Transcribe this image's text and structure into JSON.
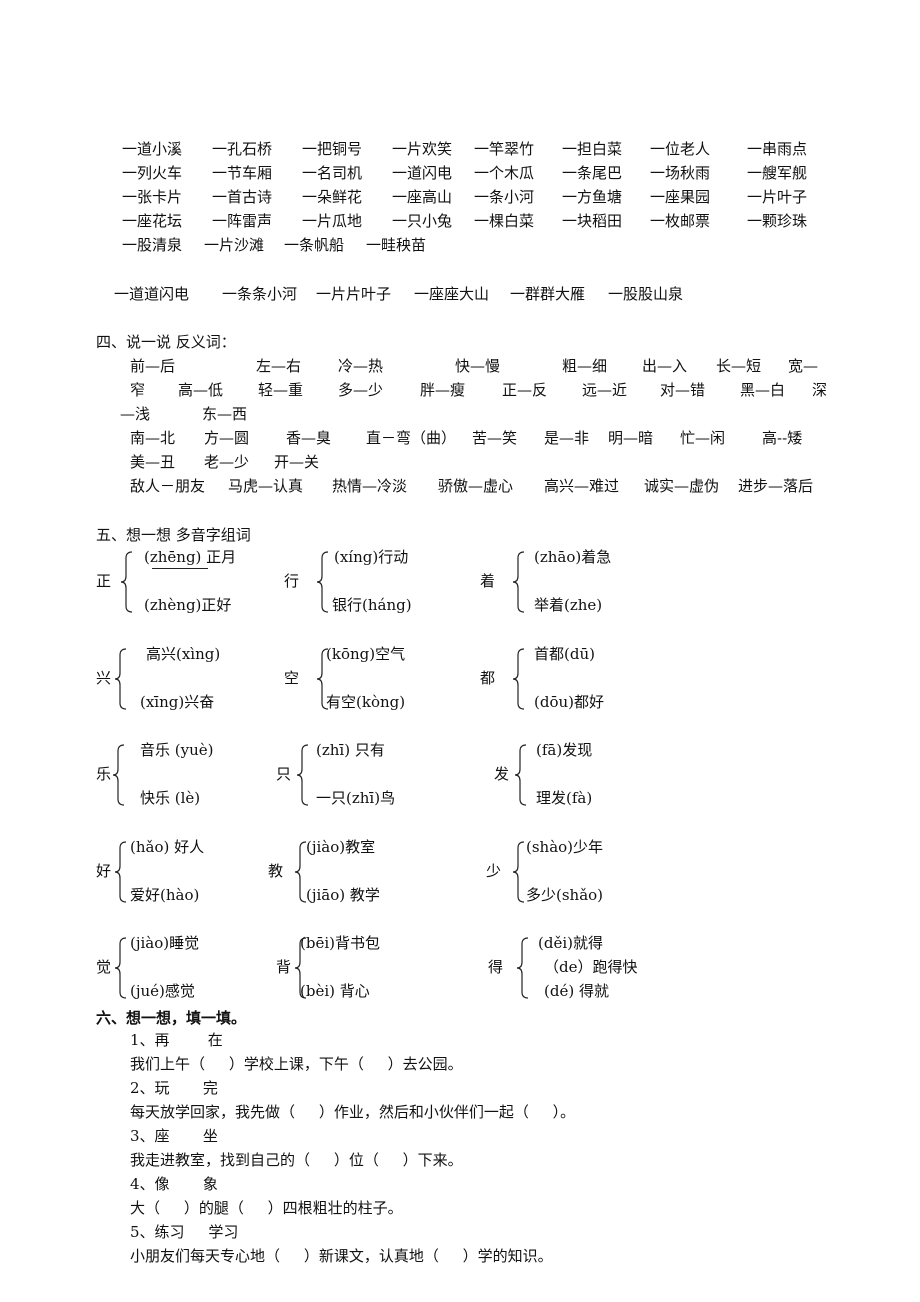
{
  "section3": {
    "measure_words": [
      [
        "一道小溪",
        "一孔石桥",
        "一把铜号",
        "一片欢笑",
        "一竿翠竹",
        "一担白菜",
        "一位老人",
        "一串雨点"
      ],
      [
        "一列火车",
        "一节车厢",
        "一名司机",
        "一道闪电",
        "一个木瓜",
        "一条尾巴",
        "一场秋雨",
        "一艘军舰"
      ],
      [
        "一张卡片",
        "一首古诗",
        "一朵鲜花",
        "一座高山",
        "一条小河",
        "一方鱼塘",
        "一座果园",
        "一片叶子"
      ],
      [
        "一座花坛",
        "一阵雷声",
        "一片瓜地",
        "一只小兔",
        "一棵白菜",
        "一块稻田",
        "一枚邮票",
        "一颗珍珠"
      ],
      [
        "一股清泉",
        "一片沙滩",
        "一条帆船",
        "一畦秧苗"
      ]
    ],
    "reduplicated": [
      "一道道闪电",
      "一条条小河",
      "一片片叶子",
      "一座座大山",
      "一群群大雁",
      "一股股山泉"
    ]
  },
  "section4": {
    "title": "四、说一说  反义词：",
    "lines": [
      [
        "前—后",
        "左—右",
        "冷—热",
        "快—慢",
        "粗—细",
        "出—入",
        "长—短",
        "宽—"
      ],
      [
        "窄",
        "高—低",
        "轻—重",
        "多—少",
        "胖—瘦",
        "正—反",
        "远—近",
        "对—错",
        "黑—白",
        "深"
      ],
      [
        "—浅",
        "东—西"
      ],
      [
        "南—北",
        "方—圆",
        "香—臭",
        "直－弯（曲）",
        "苦—笑",
        "是—非",
        "明—暗",
        "忙—闲",
        "高--矮"
      ],
      [
        "美—丑",
        "老—少",
        "开—关"
      ],
      [
        "敌人－朋友",
        "马虎—认真",
        "热情—冷淡",
        "骄傲—虚心",
        "高兴—难过",
        "诚实—虚伪",
        "进步—落后"
      ]
    ]
  },
  "section5": {
    "title": "五、想一想 多音字组词",
    "groups": [
      {
        "char": "正",
        "items": [
          "(zhēng) 正月",
          "(zhèng)正好"
        ]
      },
      {
        "char": "行",
        "items": [
          "(xíng)行动",
          "银行(háng)"
        ]
      },
      {
        "char": "着",
        "items": [
          "(zhāo)着急",
          "举着(zhe)"
        ]
      },
      {
        "char": "兴",
        "items": [
          "高兴(xìng)",
          "(xīng)兴奋"
        ]
      },
      {
        "char": "空",
        "items": [
          "(kōng)空气",
          "有空(kòng)"
        ]
      },
      {
        "char": "都",
        "items": [
          "首都(dū)",
          "(dōu)都好"
        ]
      },
      {
        "char": "乐",
        "items": [
          "音乐 (yuè)",
          "快乐 (lè)"
        ]
      },
      {
        "char": "只",
        "items": [
          "(zhī) 只有",
          "一只(zhī)鸟"
        ]
      },
      {
        "char": "发",
        "items": [
          "(fā)发现",
          "理发(fà)"
        ]
      },
      {
        "char": "好",
        "items": [
          "(hǎo) 好人",
          "爱好(hào)"
        ]
      },
      {
        "char": "教",
        "items": [
          "(jiào)教室",
          "(jiāo) 教学"
        ]
      },
      {
        "char": "少",
        "items": [
          "(shào)少年",
          "多少(shǎo)"
        ]
      },
      {
        "char": "觉",
        "items": [
          "(jiào)睡觉",
          "(jué)感觉"
        ]
      },
      {
        "char": "背",
        "items": [
          "(bēi)背书包",
          "(bèi) 背心"
        ]
      },
      {
        "char": "得",
        "items": [
          "(děi)就得",
          "（de）跑得快",
          "(dé) 得就"
        ]
      }
    ]
  },
  "section6": {
    "title": "六、想一想，填一填。",
    "items": [
      {
        "options": "1、再        在",
        "sentence": "我们上午（     ）学校上课，下午（     ）去公园。"
      },
      {
        "options": "2、玩       完",
        "sentence": "每天放学回家，我先做（     ）作业，然后和小伙伴们一起（     ）。"
      },
      {
        "options": "3、座       坐",
        "sentence": "我走进教室，找到自己的（     ）位（     ）下来。"
      },
      {
        "options": "4、像       象",
        "sentence": "大（     ）的腿（     ）四根粗壮的柱子。"
      },
      {
        "options": "5、练习     学习",
        "sentence": "小朋友们每天专心地（     ）新课文，认真地（     ）学的知识。"
      }
    ]
  }
}
